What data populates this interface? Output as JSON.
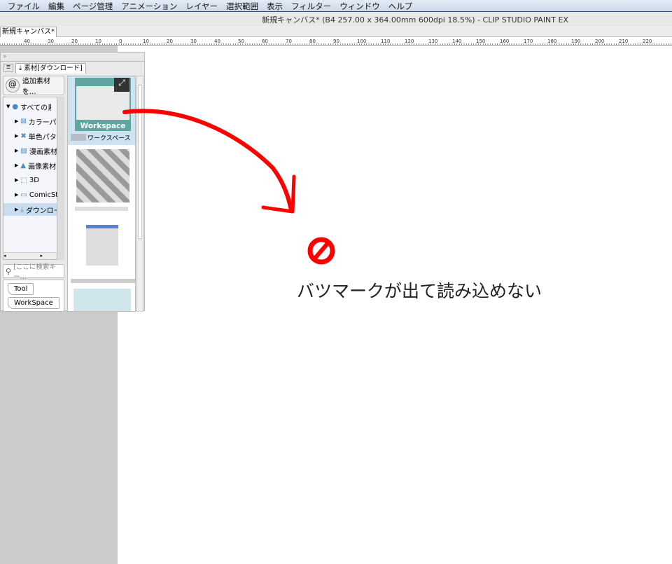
{
  "menu": [
    "ファイル",
    "編集",
    "ページ管理",
    "アニメーション",
    "レイヤー",
    "選択範囲",
    "表示",
    "フィルター",
    "ウィンドウ",
    "ヘルプ"
  ],
  "window_title": "新規キャンバス* (B4 257.00 x 364.00mm 600dpi 18.5%)  - CLIP STUDIO PAINT EX",
  "doc_tab": "新規キャンバス*",
  "ruler_labels": [
    "40",
    "30",
    "20",
    "10",
    "0",
    "10",
    "20",
    "30",
    "40",
    "50",
    "60",
    "70",
    "80",
    "90",
    "100",
    "110",
    "120",
    "130",
    "140",
    "150",
    "160",
    "170",
    "180",
    "190",
    "200",
    "210",
    "220"
  ],
  "panel": {
    "tab": "素材[ダウンロード]",
    "add_button": "追加素材を…",
    "tree": [
      {
        "label": "すべての素材",
        "icon": "globe-icon",
        "expanded": true
      },
      {
        "label": "カラーパターン",
        "icon": "color-pattern-icon"
      },
      {
        "label": "単色パターン",
        "icon": "mono-pattern-icon"
      },
      {
        "label": "漫画素材",
        "icon": "manga-icon"
      },
      {
        "label": "画像素材",
        "icon": "image-icon"
      },
      {
        "label": "3D",
        "icon": "cube-icon"
      },
      {
        "label": "ComicStudio",
        "icon": "folder-icon"
      },
      {
        "label": "ダウンロード",
        "icon": "download-icon",
        "selected": true
      }
    ],
    "search_placeholder": "[ここに検索キー…",
    "tags": [
      "Tool",
      "WorkSpace"
    ],
    "materials": [
      {
        "thumb_label": "Workspace",
        "name": "ワークスペース",
        "selected": true
      }
    ]
  },
  "annotation": {
    "text": "バツマークが出て読み込めない",
    "color": "#ff0000"
  }
}
